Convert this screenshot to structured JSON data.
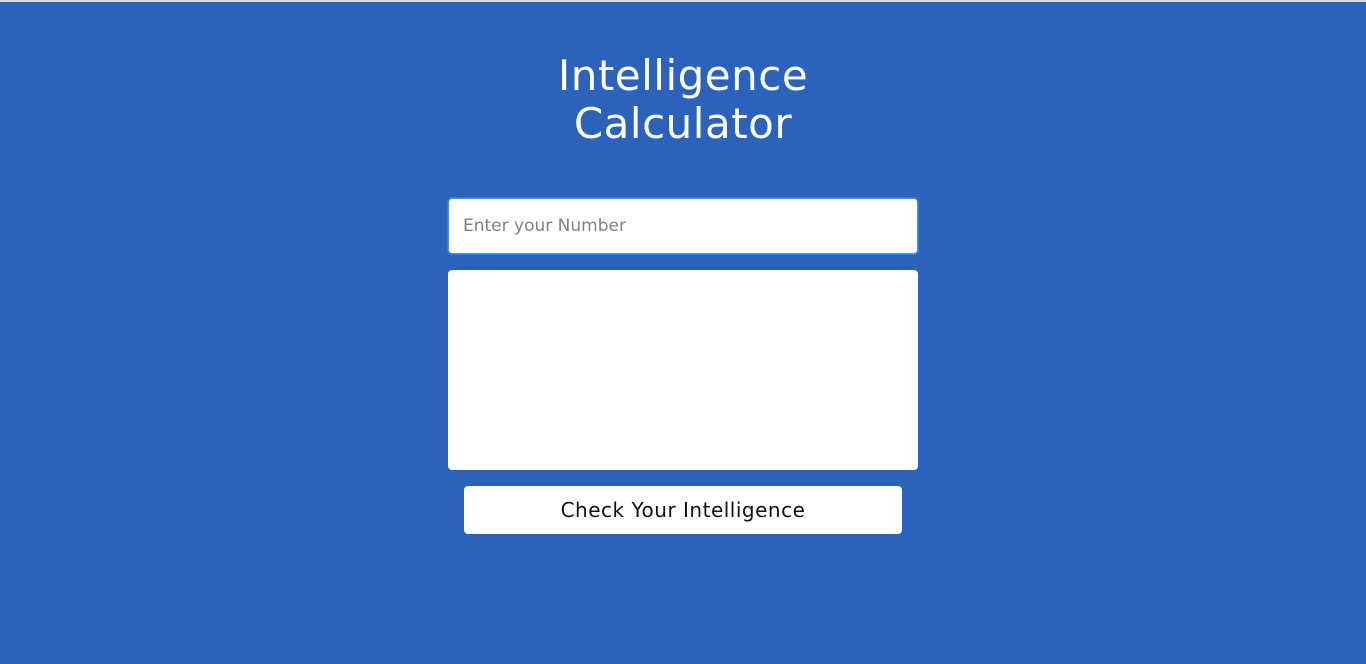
{
  "page": {
    "title_line1": "Intelligence",
    "title_line2": "Calculator"
  },
  "form": {
    "number_input": {
      "placeholder": "Enter your Number",
      "value": ""
    },
    "result_box": {
      "value": ""
    },
    "check_button_label": "Check Your Intelligence"
  },
  "colors": {
    "background": "#2a62bc",
    "text": "#ffffff",
    "button_text": "#111111"
  }
}
